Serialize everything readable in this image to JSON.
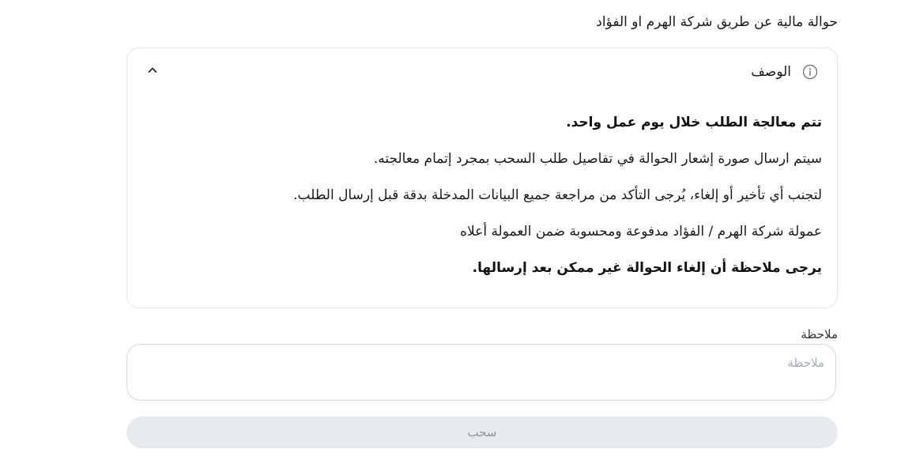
{
  "heading": "حوالة مالية عن طريق شركة الهرم او الفؤاد",
  "description_card": {
    "title": "الوصف",
    "lines": [
      "تتم معالجة الطلب خلال يوم عمل واحد.",
      "سيتم ارسال صورة إشعار الحوالة في تفاصيل طلب السحب بمجرد إتمام معالجته.",
      "لتجنب أي تأخير أو إلغاء، يُرجى التأكد من مراجعة جميع البيانات المدخلة بدقة قبل إرسال الطلب.",
      "عمولة شركة الهرم / الفؤاد مدفوعة ومحسوبة ضمن العمولة أعلاه",
      "يرجى ملاحظة أن إلغاء الحوالة غير ممكن بعد إرسالها."
    ]
  },
  "note_field": {
    "label": "ملاحظة",
    "placeholder": "ملاحظة",
    "value": ""
  },
  "submit": {
    "label": "سحب"
  },
  "icons": {
    "info": "info-icon",
    "collapse": "chevron-up-icon"
  },
  "colors": {
    "border": "#e3e6ea",
    "button_bg": "#e8ebee",
    "button_text": "#8d949b",
    "placeholder": "#a7adb3"
  }
}
